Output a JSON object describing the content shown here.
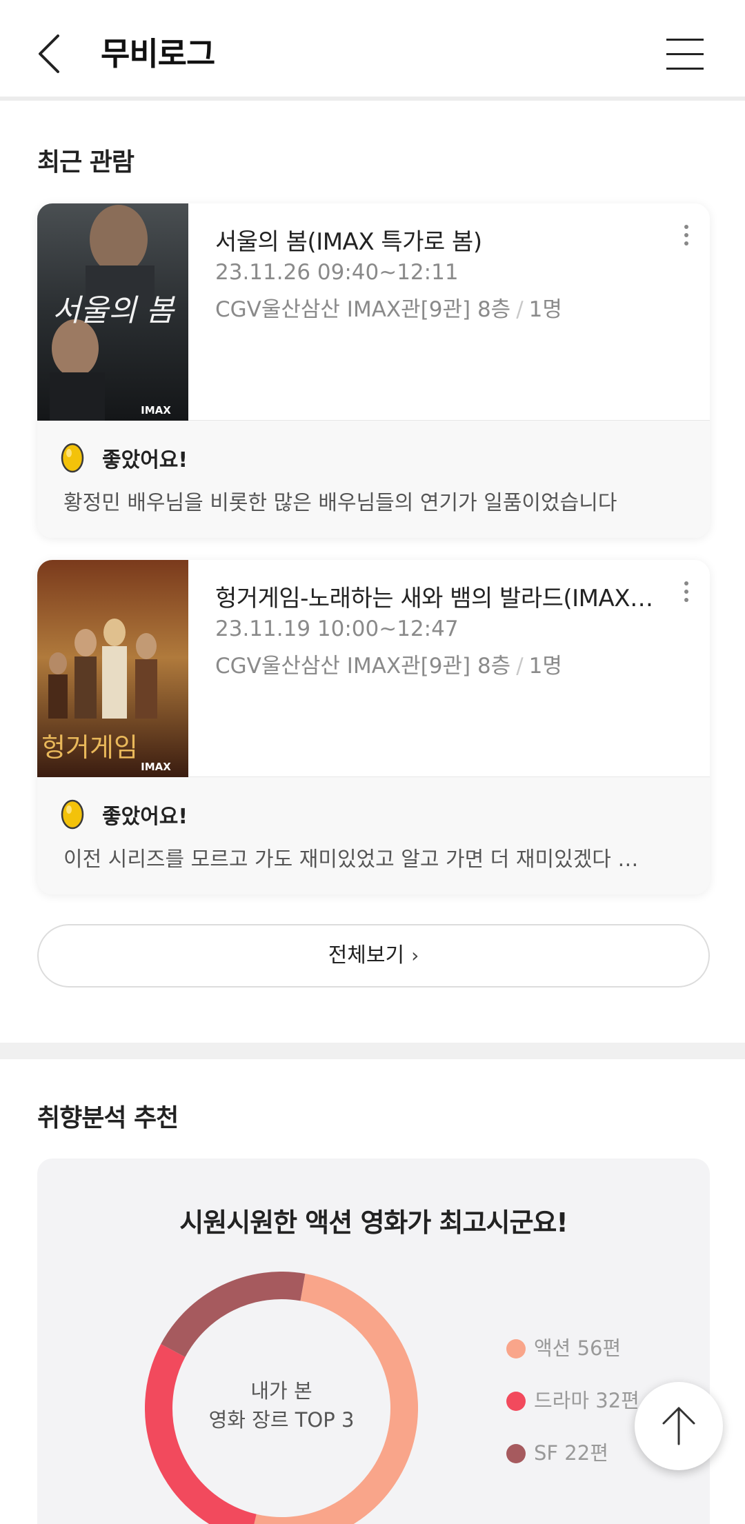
{
  "header": {
    "title": "무비로그"
  },
  "recent": {
    "section_title": "최근 관람",
    "cards": [
      {
        "title": "서울의 봄(IMAX 특가로 봄)",
        "datetime": "23.11.26 09:40~12:11",
        "theater": "CGV울산삼산 IMAX관[9관] 8층",
        "separator": "/",
        "people": "1명",
        "poster_text": "서울의 봄",
        "poster_badge": "IMAX",
        "review_label": "좋았어요!",
        "review_text": "황정민 배우님을 비롯한 많은 배우님들의 연기가 일품이었습니다"
      },
      {
        "title": "헝거게임-노래하는 새와 뱀의 발라드(IMAX…",
        "datetime": "23.11.19 10:00~12:47",
        "theater": "CGV울산삼산 IMAX관[9관] 8층",
        "separator": "/",
        "people": "1명",
        "poster_text": "헝거게임",
        "poster_badge": "IMAX",
        "review_label": "좋았어요!",
        "review_text": "이전 시리즈를 모르고 가도 재미있었고 알고 가면 더 재미있겠다 …"
      }
    ],
    "view_all_label": "전체보기"
  },
  "analysis": {
    "section_title": "취향분석 추천",
    "headline": "시원시원한 액션 영화가 최고시군요!",
    "center_line1": "내가 본",
    "center_line2": "영화 장르 TOP 3",
    "legend": [
      {
        "label": "액션 56편",
        "color": "#f9a58a"
      },
      {
        "label": "드라마 32편",
        "color": "#f24a5d"
      },
      {
        "label": "SF 22편",
        "color": "#a65a5e"
      }
    ]
  },
  "chart_data": {
    "type": "pie",
    "categories": [
      "액션",
      "드라마",
      "SF"
    ],
    "values": [
      56,
      32,
      22
    ],
    "colors": [
      "#f9a58a",
      "#f24a5d",
      "#a65a5e"
    ],
    "legend": "right"
  },
  "icons": {
    "back": "chevron-left-icon",
    "menu": "hamburger-menu-icon",
    "more": "more-vertical-icon",
    "egg": "golden-egg-icon",
    "scroll_top": "arrow-up-icon"
  }
}
